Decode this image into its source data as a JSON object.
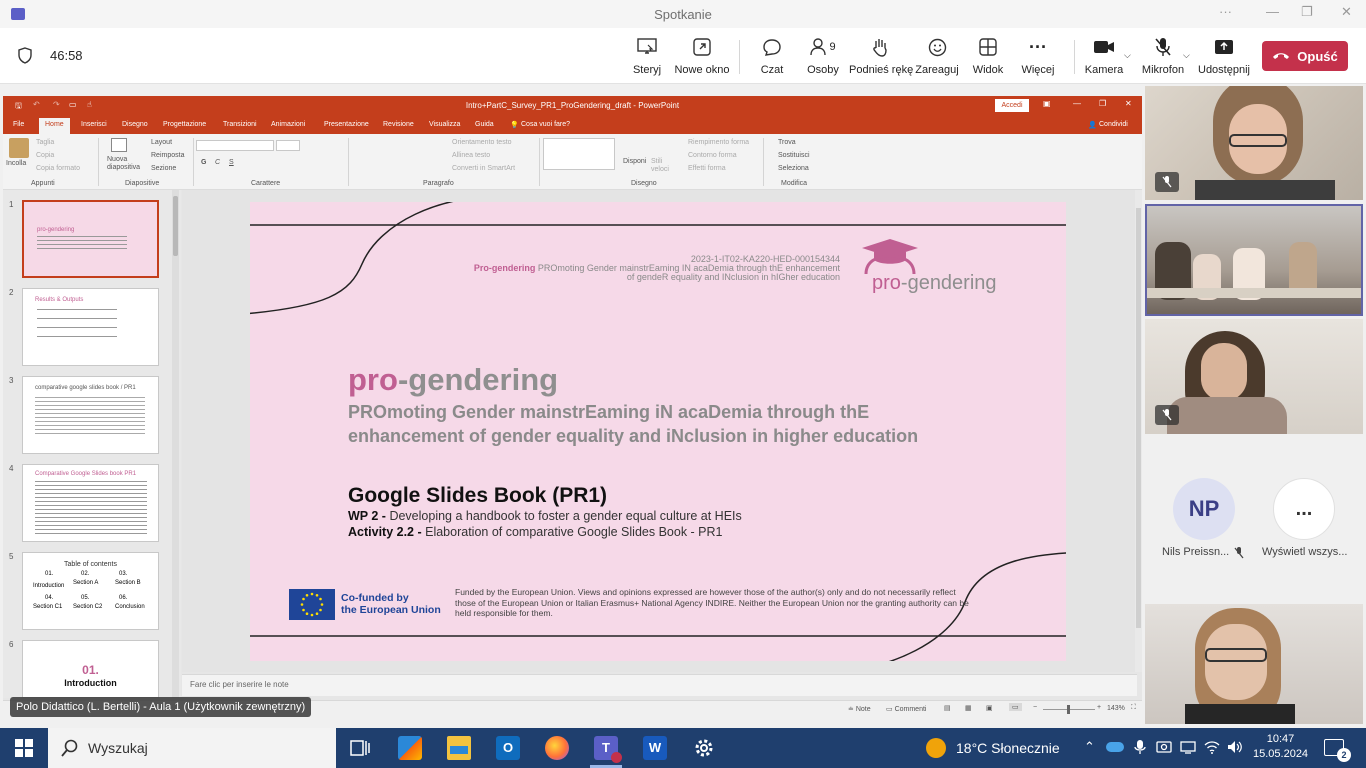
{
  "teams": {
    "window_title": "Spotkanie",
    "timer": "46:58",
    "toolbar": {
      "stop": "Sterуj",
      "popout": "Nowe okno",
      "chat": "Czat",
      "people": "Osoby",
      "people_count": "9",
      "raise": "Podnieś rękę",
      "react": "Zareaguj",
      "view": "Widok",
      "more": "Więcej",
      "camera": "Kamera",
      "mic": "Mikrofon",
      "share": "Udostępnij",
      "leave": "Opuść"
    },
    "participants": [
      {
        "initials": "NP",
        "name": "Nils Preissn..."
      },
      {
        "initials": "...",
        "name": "Wyświetl wszys..."
      }
    ],
    "caption": "Polo Didattico (L. Bertelli) - Aula 1 (Użytkownik zewnętrzny)"
  },
  "ppt": {
    "doc_title": "Intro+PartC_Survey_PR1_ProGendering_draft  -  PowerPoint",
    "signin": "Accedi",
    "tabs": [
      "File",
      "Home",
      "Inserisci",
      "Disegno",
      "Progettazione",
      "Transizioni",
      "Animazioni",
      "Presentazione",
      "Revisione",
      "Visualizza",
      "Guida"
    ],
    "tell_me": "Cosa vuoi fare?",
    "share": "Condividi",
    "ribbon": {
      "paste": "Incolla",
      "cut": "Taglia",
      "copy": "Copia",
      "format_painter": "Copia formato",
      "new_slide": "Nuova diapositiva",
      "layout": "Layout",
      "reset": "Reimposta",
      "section": "Sezione",
      "text_direction": "Orientamento testo",
      "align_text": "Allinea testo",
      "smartart": "Converti in SmartArt",
      "arrange": "Disponi",
      "quick_styles": "Stili veloci",
      "fill": "Riempimento forma",
      "outline": "Contorno forma",
      "effects": "Effetti forma",
      "find": "Trova",
      "replace": "Sostituisci",
      "select": "Seleziona",
      "groups": [
        "Appunti",
        "Diapositive",
        "Carattere",
        "Paragrafo",
        "Disegno",
        "Modifica"
      ]
    },
    "thumbs": [
      {
        "num": "1",
        "title": "pro-gendering"
      },
      {
        "num": "2",
        "title": "Results & Outputs"
      },
      {
        "num": "3",
        "title": "comparative google slides book / PR1"
      },
      {
        "num": "4",
        "title": "Comparative Google Slides book PR1"
      },
      {
        "num": "5",
        "title": "Table of contents"
      },
      {
        "num": "6",
        "title": "01.",
        "subtitle": "Introduction"
      }
    ],
    "thumb5": {
      "items": [
        {
          "num": "01.",
          "label": "Introduction"
        },
        {
          "num": "02.",
          "label": "Section A"
        },
        {
          "num": "03.",
          "label": "Section B"
        },
        {
          "num": "04.",
          "label": "Section C1"
        },
        {
          "num": "05.",
          "label": "Section C2"
        },
        {
          "num": "06.",
          "label": "Conclusion"
        }
      ]
    },
    "notes_placeholder": "Fare clic per inserire le note",
    "status": {
      "notes": "Note",
      "comments": "Commenti",
      "zoom": "143%"
    },
    "slide": {
      "project_code": "2023-1-IT02-KA220-HED-000154344",
      "subtitle_brand": "Pro-gendering",
      "subtitle_line1": " PROmoting Gender mainstrEaming IN acaDemia through thE enhancement",
      "subtitle_line2": "of gendeR equality and INclusion in hIGher education",
      "logo_pro": "pro",
      "logo_rest": "-gendering",
      "brand_pro": "pro",
      "brand_rest": "-gendering",
      "tagline": "PROmoting Gender mainstrEaming iN acaDemia through thE enhancement of gender equality and iNclusion in higher education",
      "book_title": "Google Slides Book (PR1)",
      "wp_label": "WP 2 -",
      "wp_text": " Developing a handbook to foster a gender equal culture at HEIs",
      "act_label": "Activity 2.2 -",
      "act_text": " Elaboration of comparative Google Slides Book - PR1",
      "eu_line1": "Co-funded by",
      "eu_line2": "the European Union",
      "disclaimer": "Funded by the European Union. Views and opinions expressed are however those of the author(s) only and do not necessarily reflect those of the European Union or Italian Erasmus+ National Agency INDIRE. Neither the European Union nor the granting authority can be held responsible for them."
    }
  },
  "taskbar": {
    "search": "Wyszukaj",
    "weather": "18°C  Słonecznie",
    "time": "10:47",
    "date": "15.05.2024",
    "notifications": "2"
  },
  "colors": {
    "ppt_red": "#c43e1c",
    "teams_leave": "#c4314b",
    "brand_pink": "#c05f92",
    "eu_blue": "#1f4598"
  }
}
